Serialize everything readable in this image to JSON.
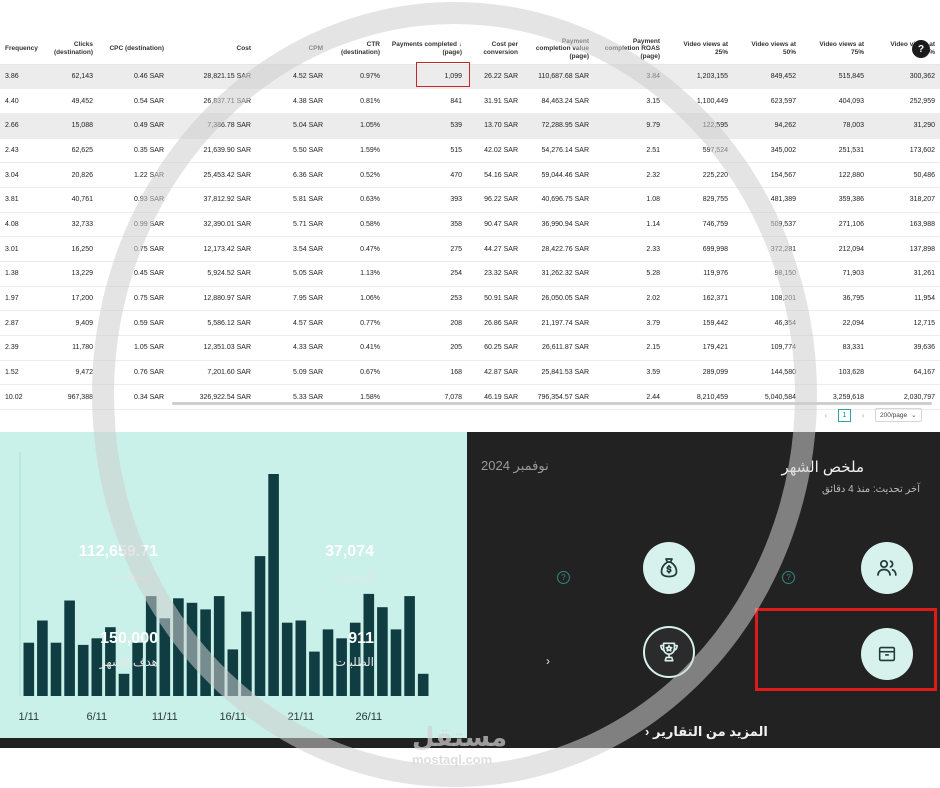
{
  "table": {
    "columns": [
      "Frequency",
      "Clicks (destination)",
      "CPC (destination)",
      "Cost",
      "CPM",
      "CTR (destination)",
      "Payments completed ↓ (page)",
      "Cost per conversion",
      "Payment completion value (page)",
      "Payment completion ROAS (page)",
      "Video views at 25%",
      "Video views at 50%",
      "Video views at 75%",
      "Video views at 100%"
    ],
    "rows": [
      [
        "3.86",
        "62,143",
        "0.46 SAR",
        "28,821.15 SAR",
        "4.52 SAR",
        "0.97%",
        "1,099",
        "26.22 SAR",
        "110,687.68 SAR",
        "3.84",
        "1,203,155",
        "849,452",
        "515,845",
        "300,362"
      ],
      [
        "4.40",
        "49,452",
        "0.54 SAR",
        "26,837.71 SAR",
        "4.38 SAR",
        "0.81%",
        "841",
        "31.91 SAR",
        "84,463.24 SAR",
        "3.15",
        "1,100,449",
        "623,597",
        "404,093",
        "252,959"
      ],
      [
        "2.66",
        "15,088",
        "0.49 SAR",
        "7,386.78 SAR",
        "5.04 SAR",
        "1.05%",
        "539",
        "13.70 SAR",
        "72,288.95 SAR",
        "9.79",
        "122,595",
        "94,262",
        "78,003",
        "31,290"
      ],
      [
        "2.43",
        "62,625",
        "0.35 SAR",
        "21,639.90 SAR",
        "5.50 SAR",
        "1.59%",
        "515",
        "42.02 SAR",
        "54,276.14 SAR",
        "2.51",
        "597,524",
        "345,002",
        "251,531",
        "173,602"
      ],
      [
        "3.04",
        "20,826",
        "1.22 SAR",
        "25,453.42 SAR",
        "6.36 SAR",
        "0.52%",
        "470",
        "54.16 SAR",
        "59,044.46 SAR",
        "2.32",
        "225,220",
        "154,567",
        "122,880",
        "50,486"
      ],
      [
        "3.81",
        "40,761",
        "0.93 SAR",
        "37,812.92 SAR",
        "5.81 SAR",
        "0.63%",
        "393",
        "96.22 SAR",
        "40,696.75 SAR",
        "1.08",
        "829,755",
        "481,389",
        "359,386",
        "318,207"
      ],
      [
        "4.08",
        "32,733",
        "0.99 SAR",
        "32,390.01 SAR",
        "5.71 SAR",
        "0.58%",
        "358",
        "90.47 SAR",
        "36,990.94 SAR",
        "1.14",
        "746,759",
        "509,537",
        "271,106",
        "163,988"
      ],
      [
        "3.01",
        "16,250",
        "0.75 SAR",
        "12,173.42 SAR",
        "3.54 SAR",
        "0.47%",
        "275",
        "44.27 SAR",
        "28,422.76 SAR",
        "2.33",
        "699,998",
        "372,281",
        "212,094",
        "137,898"
      ],
      [
        "1.38",
        "13,229",
        "0.45 SAR",
        "5,924.52 SAR",
        "5.05 SAR",
        "1.13%",
        "254",
        "23.32 SAR",
        "31,262.32 SAR",
        "5.28",
        "119,976",
        "98,150",
        "71,903",
        "31,261"
      ],
      [
        "1.97",
        "17,200",
        "0.75 SAR",
        "12,880.97 SAR",
        "7.95 SAR",
        "1.06%",
        "253",
        "50.91 SAR",
        "26,050.05 SAR",
        "2.02",
        "162,371",
        "108,201",
        "36,795",
        "11,954"
      ],
      [
        "2.87",
        "9,409",
        "0.59 SAR",
        "5,586.12 SAR",
        "4.57 SAR",
        "0.77%",
        "208",
        "26.86 SAR",
        "21,197.74 SAR",
        "3.79",
        "159,442",
        "46,354",
        "22,094",
        "12,715"
      ],
      [
        "2.39",
        "11,780",
        "1.05 SAR",
        "12,351.03 SAR",
        "4.33 SAR",
        "0.41%",
        "205",
        "60.25 SAR",
        "26,611.87 SAR",
        "2.15",
        "179,421",
        "109,774",
        "83,331",
        "39,636"
      ],
      [
        "1.52",
        "9,472",
        "0.76 SAR",
        "7,201.60 SAR",
        "5.09 SAR",
        "0.67%",
        "168",
        "42.87 SAR",
        "25,841.53 SAR",
        "3.59",
        "289,099",
        "144,580",
        "103,628",
        "64,167"
      ]
    ],
    "total": [
      "10.02",
      "967,388",
      "0.34 SAR",
      "326,922.54 SAR",
      "5.33 SAR",
      "1.58%",
      "7,078",
      "46.19 SAR",
      "796,354.57 SAR",
      "2.44",
      "8,210,459",
      "5,040,584",
      "3,259,618",
      "2,030,797"
    ],
    "help": "?",
    "pagination": {
      "prev": "‹",
      "page": "1",
      "next": "›",
      "page_size": "200/page",
      "size_caret": "⌄"
    }
  },
  "summary": {
    "title": "ملخص الشهر",
    "month": "نوفمبر 2024",
    "updated": "آخر تحديث: منذ 4 دقائق",
    "metrics": {
      "visits": {
        "value": "37,074",
        "label": "الزيارات",
        "icon": "users-icon"
      },
      "sales": {
        "value": "112,659.71",
        "label": "المبيعات",
        "icon": "money-bag-icon"
      },
      "orders": {
        "value": "911",
        "label": "الطلبات",
        "icon": "box-icon"
      },
      "goal": {
        "value": "150,000",
        "label": "هدف الشهر",
        "icon": "trophy-icon",
        "chevron": "‹"
      }
    },
    "more_reports": "المزيد من التقارير",
    "more_chevron": "‹",
    "help_glyph": "?"
  },
  "chart_data": {
    "type": "bar",
    "x_tick_labels": [
      "1/11",
      "6/11",
      "11/11",
      "16/11",
      "21/11",
      "26/11"
    ],
    "categories": [
      "1/11",
      "2/11",
      "3/11",
      "4/11",
      "5/11",
      "6/11",
      "7/11",
      "8/11",
      "9/11",
      "10/11",
      "11/11",
      "12/11",
      "13/11",
      "14/11",
      "15/11",
      "16/11",
      "17/11",
      "18/11",
      "19/11",
      "20/11",
      "21/11",
      "22/11",
      "23/11",
      "24/11",
      "25/11",
      "26/11",
      "27/11",
      "28/11",
      "29/11",
      "30/11"
    ],
    "values": [
      24,
      34,
      24,
      43,
      23,
      26,
      31,
      10,
      24,
      45,
      35,
      44,
      42,
      39,
      45,
      21,
      38,
      63,
      100,
      33,
      34,
      20,
      30,
      26,
      33,
      46,
      40,
      30,
      45,
      10
    ],
    "grid": false,
    "color": "#0f3d42",
    "background": "#c9f1e9"
  },
  "watermark": {
    "text": "مستقل",
    "sub": "mostaql.com"
  }
}
